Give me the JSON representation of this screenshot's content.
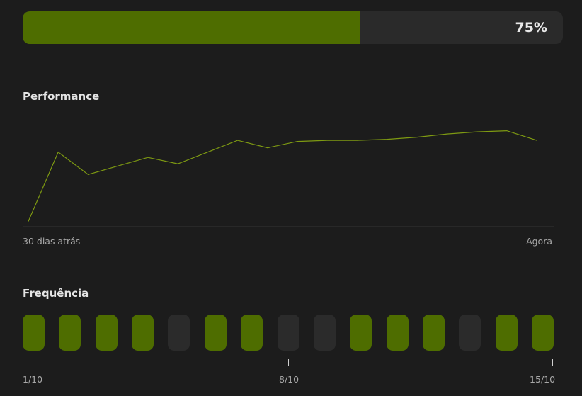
{
  "progress": {
    "percent": 62.5,
    "label": "75%"
  },
  "performance": {
    "title": "Performance",
    "start_label": "30 dias atrás",
    "end_label": "Agora",
    "line_color": "#7e9a12",
    "values": [
      5,
      70,
      49,
      57,
      65,
      59,
      70,
      81,
      74,
      80,
      81,
      81,
      82,
      84,
      87,
      89,
      90,
      81
    ]
  },
  "frequency": {
    "title": "Frequência",
    "active_color": "#4e6d00",
    "inactive_color": "#2b2b2b",
    "days": [
      true,
      true,
      true,
      true,
      false,
      true,
      true,
      false,
      false,
      true,
      true,
      true,
      false,
      true,
      true
    ],
    "ticks": [
      "1/10",
      "8/10",
      "15/10"
    ]
  }
}
